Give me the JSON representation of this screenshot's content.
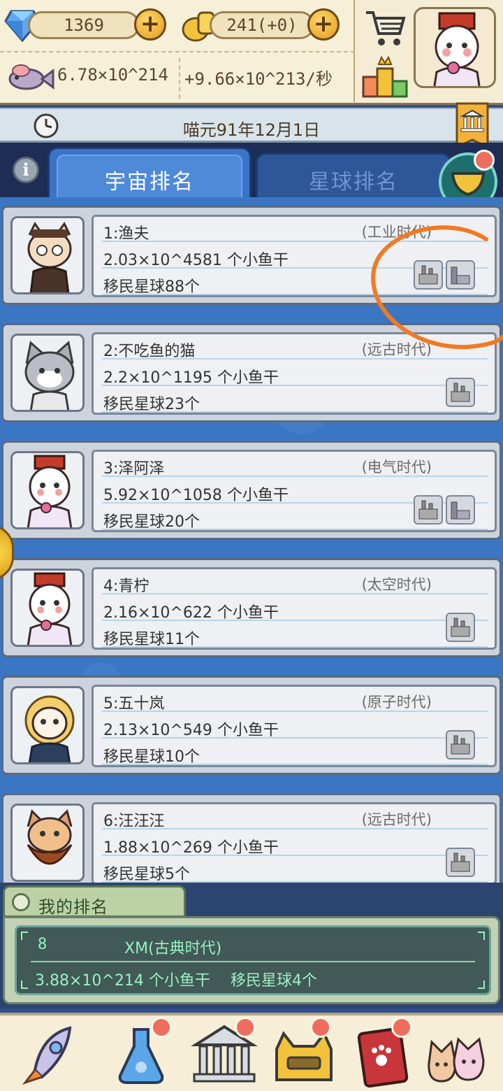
{
  "resources": {
    "gems": "1369",
    "coins": "241(+0)",
    "fish_total": "6.78×10^214",
    "fish_rate": "+9.66×10^213/秒"
  },
  "date": "喵元91年12月1日",
  "tabs": {
    "universe": "宇宙排名",
    "planet": "星球排名"
  },
  "rankings": [
    {
      "name": "1:渔夫",
      "era": "(工业时代)",
      "fish": "2.03×10^4581 个小鱼干",
      "planets": "移民星球88个",
      "icons": 2
    },
    {
      "name": "2:不吃鱼的猫",
      "era": "(远古时代)",
      "fish": "2.2×10^1195 个小鱼干",
      "planets": "移民星球23个",
      "icons": 1
    },
    {
      "name": "3:泽阿泽",
      "era": "(电气时代)",
      "fish": "5.92×10^1058 个小鱼干",
      "planets": "移民星球20个",
      "icons": 2
    },
    {
      "name": "4:青柠",
      "era": "(太空时代)",
      "fish": "2.16×10^622 个小鱼干",
      "planets": "移民星球11个",
      "icons": 1
    },
    {
      "name": "5:五十岚",
      "era": "(原子时代)",
      "fish": "2.13×10^549 个小鱼干",
      "planets": "移民星球10个",
      "icons": 1
    },
    {
      "name": "6:汪汪汪",
      "era": "(远古时代)",
      "fish": "1.88×10^269 个小鱼干",
      "planets": "移民星球5个",
      "icons": 1
    }
  ],
  "my_rank": {
    "title": "我的排名",
    "rank": "8",
    "name": "XM(古典时代)",
    "fish": "3.88×10^214 个小鱼干",
    "planets": "移民星球4个"
  },
  "colors": {
    "accent_blue": "#3a76c4",
    "panel_cream": "#f4ecd3",
    "my_rank_text": "#9bf0c3",
    "annotation_circle": "#f07a24"
  }
}
